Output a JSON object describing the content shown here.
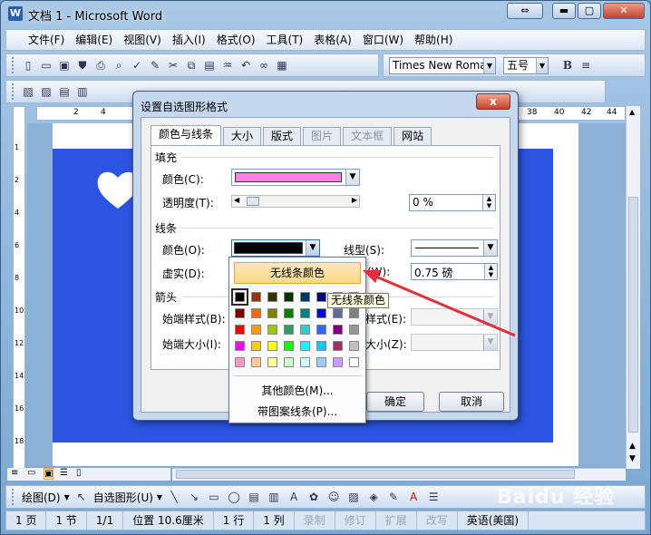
{
  "window": {
    "title": "文档 1 - Microsoft Word",
    "app_icon": "W"
  },
  "menu": [
    "文件(F)",
    "编辑(E)",
    "视图(V)",
    "插入(I)",
    "格式(O)",
    "工具(T)",
    "表格(A)",
    "窗口(W)",
    "帮助(H)"
  ],
  "formatting": {
    "font": "Times New Roman",
    "size": "五号",
    "bold": "B"
  },
  "ruler": {
    "ticks": [
      "2",
      "4",
      "38",
      "40",
      "42",
      "44"
    ],
    "vticks": [
      "1",
      "2",
      "4",
      "6",
      "8",
      "10",
      "12",
      "14",
      "16",
      "18"
    ]
  },
  "dialog": {
    "title": "设置自选图形格式",
    "close": "x",
    "tabs": [
      "颜色与线条",
      "大小",
      "版式",
      "图片",
      "文本框",
      "网站"
    ],
    "fill_section": "填充",
    "fill_color_label": "颜色(C):",
    "transparency_label": "透明度(T):",
    "transparency_value": "0 %",
    "line_section": "线条",
    "line_color_label": "颜色(O):",
    "line_style_label": "线型(S):",
    "dash_label": "虚实(D):",
    "weight_label": "(W):",
    "weight_value": "0.75 磅",
    "arrows_section": "箭头",
    "begin_style_label": "始端样式(B):",
    "begin_size_label": "始端大小(I):",
    "end_style_label": "样式(E):",
    "end_size_label": "大小(Z):",
    "ok": "确定",
    "cancel": "取消",
    "fill_color_hex": "#ff7fe8",
    "line_color_hex": "#000000"
  },
  "palette": {
    "no_line": "无线条颜色",
    "more_colors": "其他颜色(M)...",
    "patterned": "带图案线条(P)...",
    "tooltip": "无线条颜色",
    "colors": [
      "#000000",
      "#993300",
      "#333300",
      "#003300",
      "#003366",
      "#000080",
      "#333399",
      "#333333",
      "#800000",
      "#FF6600",
      "#808000",
      "#008000",
      "#008080",
      "#0000FF",
      "#666699",
      "#808080",
      "#FF0000",
      "#FF9900",
      "#99CC00",
      "#339966",
      "#33CCCC",
      "#3366FF",
      "#800080",
      "#969696",
      "#FF00FF",
      "#FFCC00",
      "#FFFF00",
      "#00FF00",
      "#00FFFF",
      "#00CCFF",
      "#993366",
      "#C0C0C0",
      "#FF99CC",
      "#FFCC99",
      "#FFFF99",
      "#CCFFCC",
      "#CCFFFF",
      "#99CCFF",
      "#CC99FF",
      "#FFFFFF"
    ]
  },
  "drawbar": {
    "draw": "绘图(D)",
    "autoshapes": "自选图形(U)"
  },
  "status": [
    {
      "text": "1 页",
      "dim": false
    },
    {
      "text": "1 节",
      "dim": false
    },
    {
      "text": "1/1",
      "dim": false
    },
    {
      "text": "位置 10.6厘米",
      "dim": false
    },
    {
      "text": "1 行",
      "dim": false
    },
    {
      "text": "1 列",
      "dim": false
    },
    {
      "text": "录制",
      "dim": true
    },
    {
      "text": "修订",
      "dim": true
    },
    {
      "text": "扩展",
      "dim": true
    },
    {
      "text": "改写",
      "dim": true
    },
    {
      "text": "英语(美国)",
      "dim": false
    }
  ],
  "watermark": "Baidu 经验"
}
